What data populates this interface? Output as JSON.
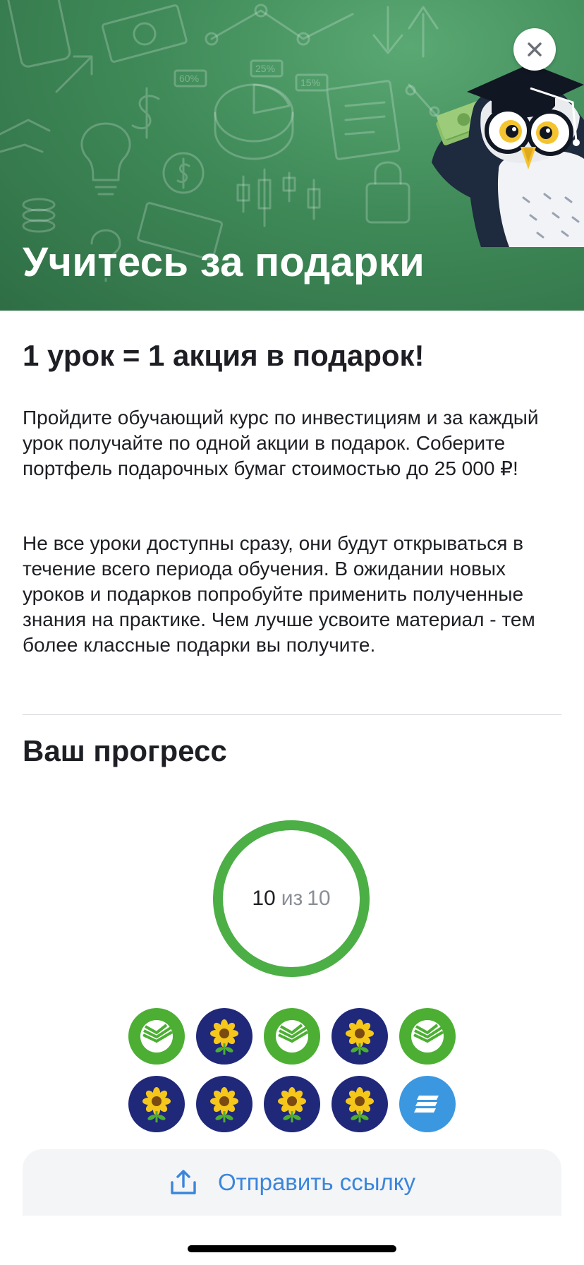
{
  "header": {
    "title": "Учитесь за подарки",
    "close_icon": "close-icon",
    "doodle_labels": [
      "60%",
      "25%",
      "15%"
    ],
    "mascot": "owl-mascot-with-money"
  },
  "content": {
    "subtitle": "1 урок = 1 акция в подарок!",
    "paragraph1": "Пройдите обучающий курс по инвестициям и за каждый урок получайте по одной акции в подарок. Соберите портфель подарочных бумаг стоимостью до 25 000 ₽!",
    "paragraph2": "Не все уроки доступны сразу, они будут открываться в течение всего периода обучения. В ожидании новых уроков и подарков попробуйте применить полученные знания на практике. Чем лучше усвоите материал - тем более классные подарки вы получите."
  },
  "progress": {
    "title": "Ваш прогресс",
    "completed": "10",
    "of_label": "из",
    "total": "10",
    "fraction_complete": 1.0,
    "ring_color": "#4caf46",
    "badges": [
      {
        "icon": "sberbank-logo-icon",
        "color": "#4caf33"
      },
      {
        "icon": "sunflower-icon",
        "color": "#20287a"
      },
      {
        "icon": "sberbank-logo-icon",
        "color": "#4caf33"
      },
      {
        "icon": "sunflower-icon",
        "color": "#20287a"
      },
      {
        "icon": "sberbank-logo-icon",
        "color": "#4caf33"
      },
      {
        "icon": "sunflower-icon",
        "color": "#20287a"
      },
      {
        "icon": "sunflower-icon",
        "color": "#20287a"
      },
      {
        "icon": "sunflower-icon",
        "color": "#20287a"
      },
      {
        "icon": "sunflower-icon",
        "color": "#20287a"
      },
      {
        "icon": "striped-lines-logo-icon",
        "color": "#3b98e0"
      }
    ]
  },
  "share": {
    "label": "Отправить ссылку",
    "icon": "share-upload-icon",
    "color": "#3a86dc"
  }
}
